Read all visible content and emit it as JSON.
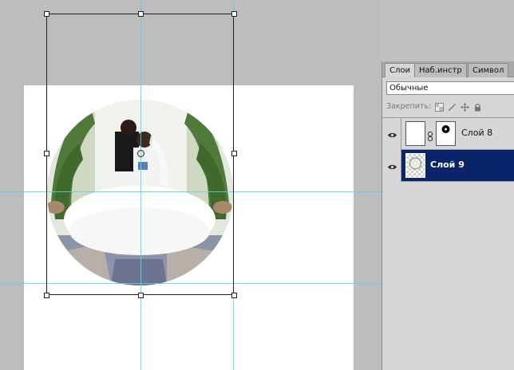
{
  "layers_panel": {
    "tabs": [
      {
        "label": "Слои"
      },
      {
        "label": "Наб.инстр"
      },
      {
        "label": "Символ"
      }
    ],
    "blend_mode": "Обычные",
    "lock_label": "Закрепить:",
    "layers": [
      {
        "name": "Слой 8",
        "selected": false,
        "has_mask": true
      },
      {
        "name": "Слой 9",
        "selected": true,
        "has_mask": false
      }
    ]
  },
  "colors": {
    "workspace": "#bdbdbd",
    "canvas": "#ffffff",
    "guide": "#4fd9e4",
    "selected_layer": "#0a246a"
  },
  "icons": [
    "eye-icon",
    "link-icon",
    "lock-transparency-icon",
    "brush-icon",
    "move-icon",
    "lock-icon"
  ]
}
